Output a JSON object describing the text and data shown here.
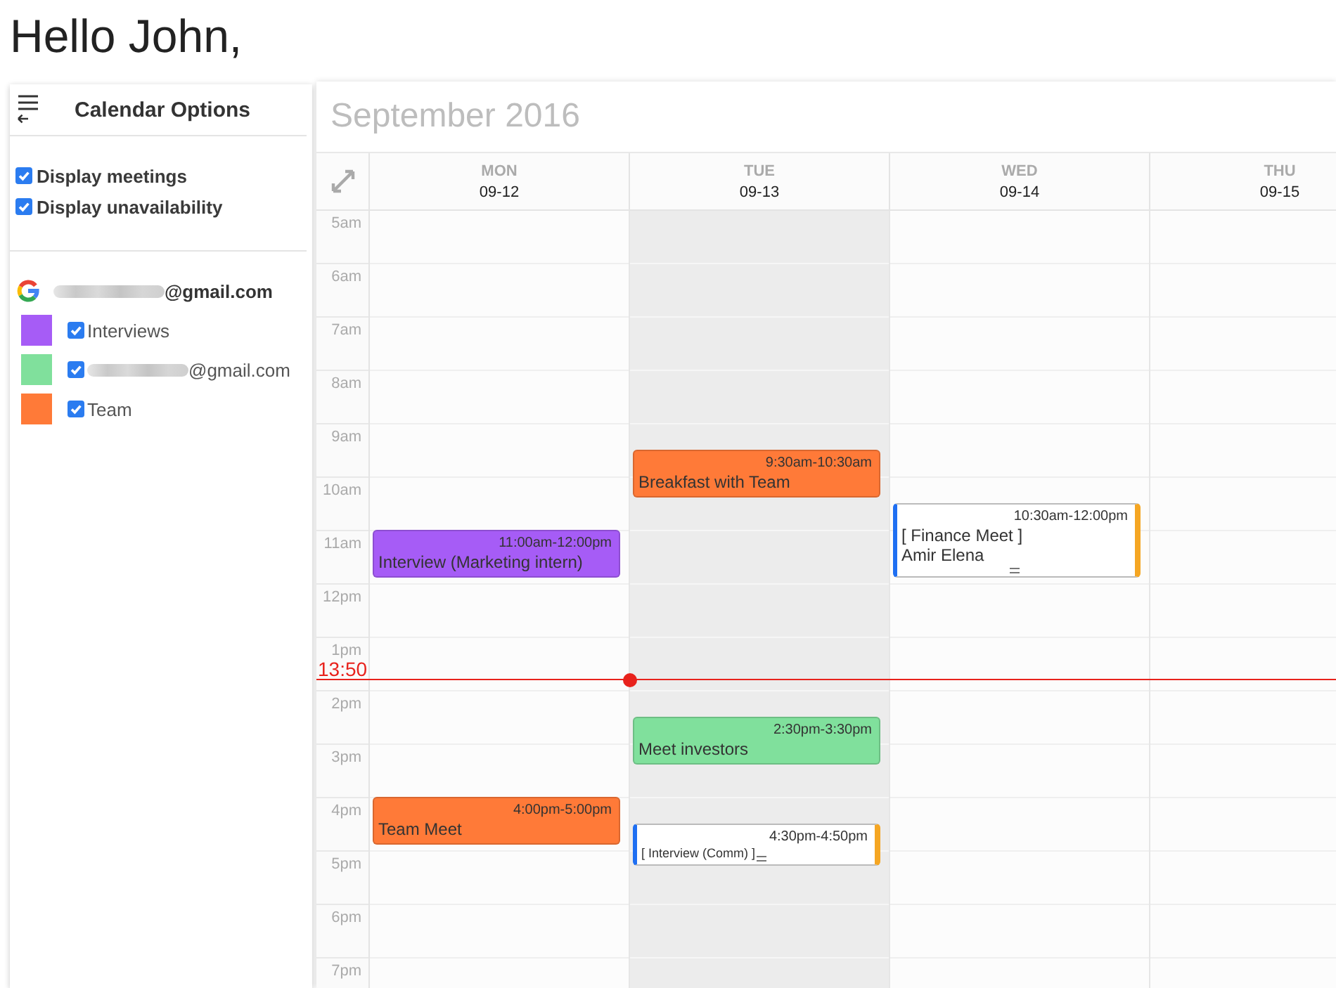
{
  "greeting": "Hello John,",
  "sidebar": {
    "title": "Calendar Options",
    "options": [
      {
        "label": "Display meetings",
        "checked": true
      },
      {
        "label": "Display unavailability",
        "checked": true
      }
    ],
    "account": {
      "email": "@gmail.com",
      "redacted_prefix": true
    },
    "calendars": [
      {
        "name": "Interviews",
        "color": "#a65cf6",
        "checked": true,
        "redacted_prefix": false
      },
      {
        "name": "@gmail.com",
        "color": "#80e09c",
        "checked": true,
        "redacted_prefix": true
      },
      {
        "name": "Team",
        "color": "#ff7a38",
        "checked": true,
        "redacted_prefix": false
      }
    ]
  },
  "calendar": {
    "title": "September 2016",
    "hours": [
      "5am",
      "6am",
      "7am",
      "8am",
      "9am",
      "10am",
      "11am",
      "12pm",
      "1pm",
      "2pm",
      "3pm",
      "4pm",
      "5pm",
      "6pm",
      "7pm"
    ],
    "days": [
      {
        "weekday": "MON",
        "date": "09-12",
        "today": false,
        "events": [
          {
            "kind": "block",
            "time": "11:00am-12:00pm",
            "title": "Interview (Marketing intern)",
            "color": "#a65cf6"
          },
          {
            "kind": "block",
            "time": "4:00pm-5:00pm",
            "title": "Team Meet",
            "color": "#ff7a38"
          }
        ]
      },
      {
        "weekday": "TUE",
        "date": "09-13",
        "today": true,
        "events": [
          {
            "kind": "block",
            "time": "9:30am-10:30am",
            "title": "Breakfast with Team",
            "color": "#ff7a38"
          },
          {
            "kind": "block",
            "time": "2:30pm-3:30pm",
            "title": "Meet investors",
            "color": "#80e09c"
          },
          {
            "kind": "outlined",
            "time": "4:30pm-4:50pm",
            "title": "[ Interview (Comm) ]"
          }
        ]
      },
      {
        "weekday": "WED",
        "date": "09-14",
        "today": false,
        "events": [
          {
            "kind": "outlined",
            "time": "10:30am-12:00pm",
            "title": "[ Finance Meet ]",
            "attendee": "Amir Elena"
          }
        ]
      },
      {
        "weekday": "THU",
        "date": "09-15",
        "today": false
      }
    ],
    "now": {
      "label": "13:50"
    }
  }
}
